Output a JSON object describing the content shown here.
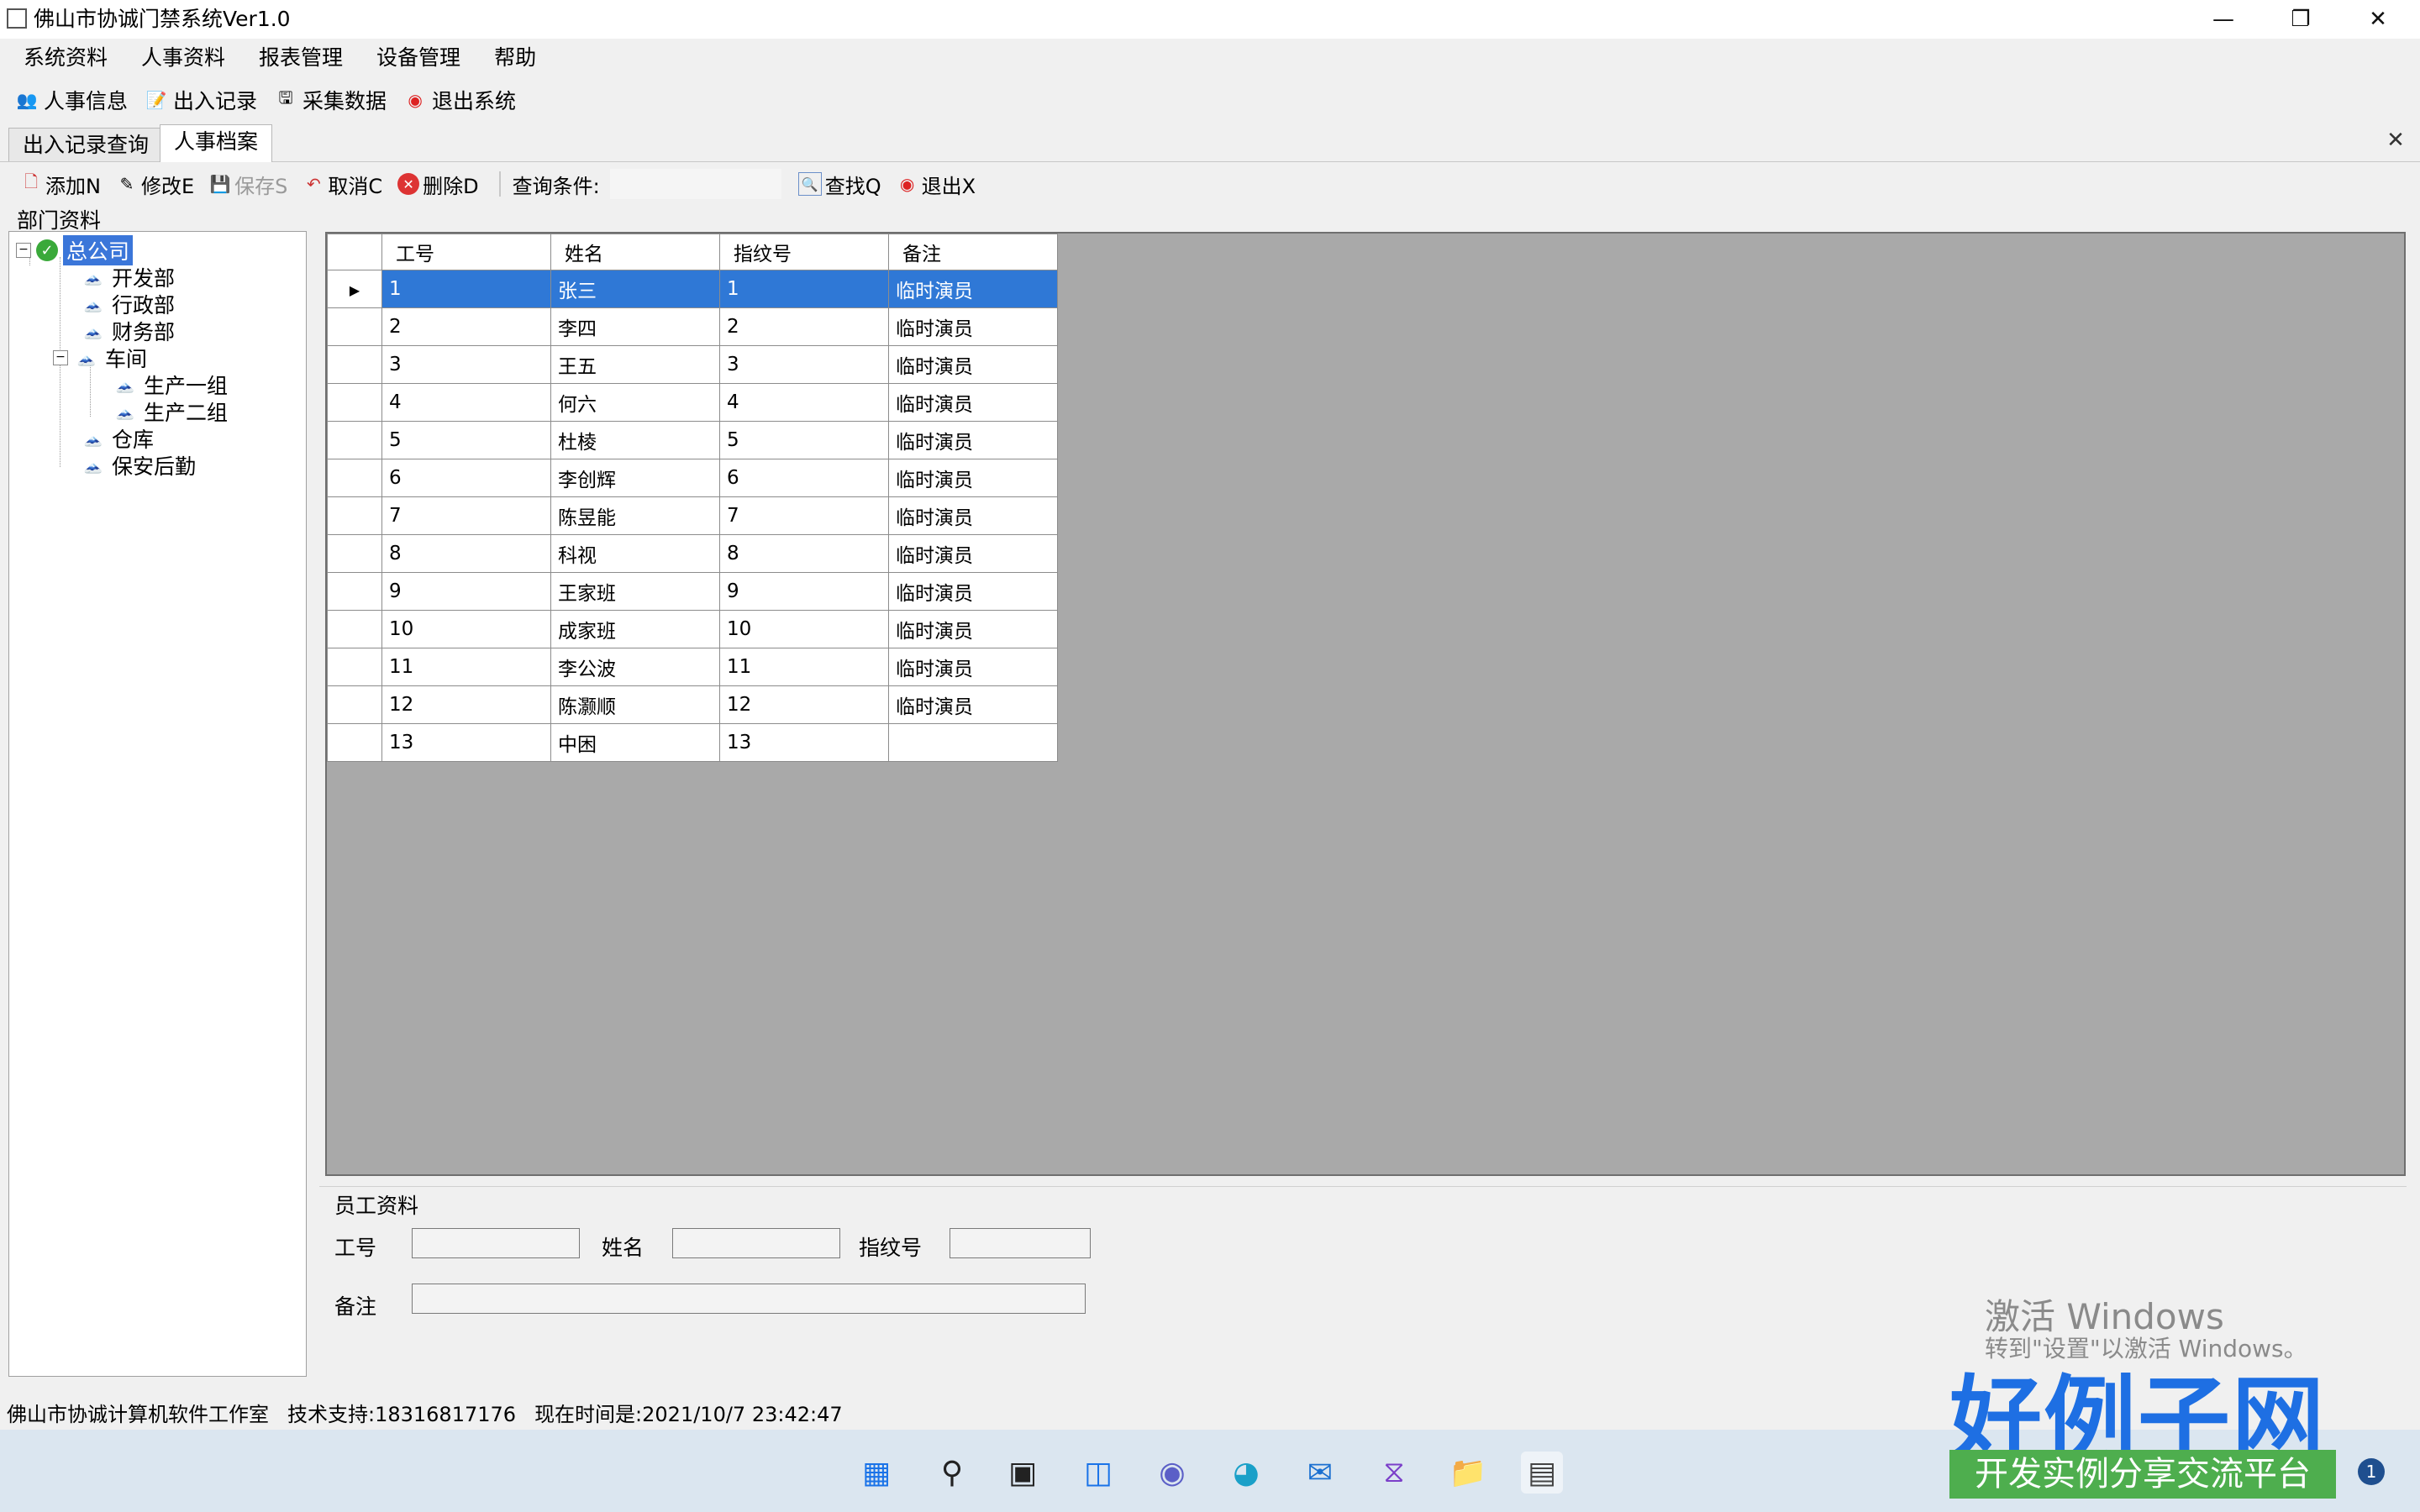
{
  "window": {
    "title": "佛山市协诚门禁系统Ver1.0"
  },
  "menu": [
    "系统资料",
    "人事资料",
    "报表管理",
    "设备管理",
    "帮助"
  ],
  "toolbar": [
    {
      "label": "人事信息",
      "icon": "people-icon"
    },
    {
      "label": "出入记录",
      "icon": "edit-record-icon"
    },
    {
      "label": "采集数据",
      "icon": "collect-data-icon"
    },
    {
      "label": "退出系统",
      "icon": "exit-icon"
    }
  ],
  "tabs": [
    {
      "label": "出入记录查询",
      "active": false
    },
    {
      "label": "人事档案",
      "active": true
    }
  ],
  "actions": {
    "add": "添加N",
    "edit": "修改E",
    "save": "保存S",
    "cancel": "取消C",
    "delete": "删除D",
    "query_label": "查询条件:",
    "find": "查找Q",
    "exit": "退出X"
  },
  "department": {
    "title": "部门资料",
    "root": "总公司",
    "items": [
      "开发部",
      "行政部",
      "财务部",
      "车间",
      "生产一组",
      "生产二组",
      "仓库",
      "保安后勤"
    ]
  },
  "grid": {
    "columns": [
      "工号",
      "姓名",
      "指纹号",
      "备注"
    ],
    "rows": [
      [
        "1",
        "张三",
        "1",
        "临时演员"
      ],
      [
        "2",
        "李四",
        "2",
        "临时演员"
      ],
      [
        "3",
        "王五",
        "3",
        "临时演员"
      ],
      [
        "4",
        "何六",
        "4",
        "临时演员"
      ],
      [
        "5",
        "杜棱",
        "5",
        "临时演员"
      ],
      [
        "6",
        "李创辉",
        "6",
        "临时演员"
      ],
      [
        "7",
        "陈昱能",
        "7",
        "临时演员"
      ],
      [
        "8",
        "科视",
        "8",
        "临时演员"
      ],
      [
        "9",
        "王家班",
        "9",
        "临时演员"
      ],
      [
        "10",
        "成家班",
        "10",
        "临时演员"
      ],
      [
        "11",
        "李公波",
        "11",
        "临时演员"
      ],
      [
        "12",
        "陈灏顺",
        "12",
        "临时演员"
      ],
      [
        "13",
        "中困",
        "13",
        ""
      ]
    ],
    "selected_row": 0
  },
  "employee": {
    "title": "员工资料",
    "id_label": "工号",
    "name_label": "姓名",
    "finger_label": "指纹号",
    "remark_label": "备注"
  },
  "status": {
    "company": "佛山市协诚计算机软件工作室",
    "support": "技术支持:18316817176",
    "time": "现在时间是:2021/10/7 23:42:47"
  },
  "overlay": {
    "activate_title": "激活 Windows",
    "activate_sub": "转到\"设置\"以激活 Windows。",
    "logo": "好例子网",
    "tagline": "开发实例分享交流平台",
    "badge": "1"
  },
  "colors": {
    "selection": "#2f78d6",
    "grid_bg": "#a9a9a9",
    "logo": "#1e6fe3",
    "tagline_bg": "#4eae4e"
  }
}
